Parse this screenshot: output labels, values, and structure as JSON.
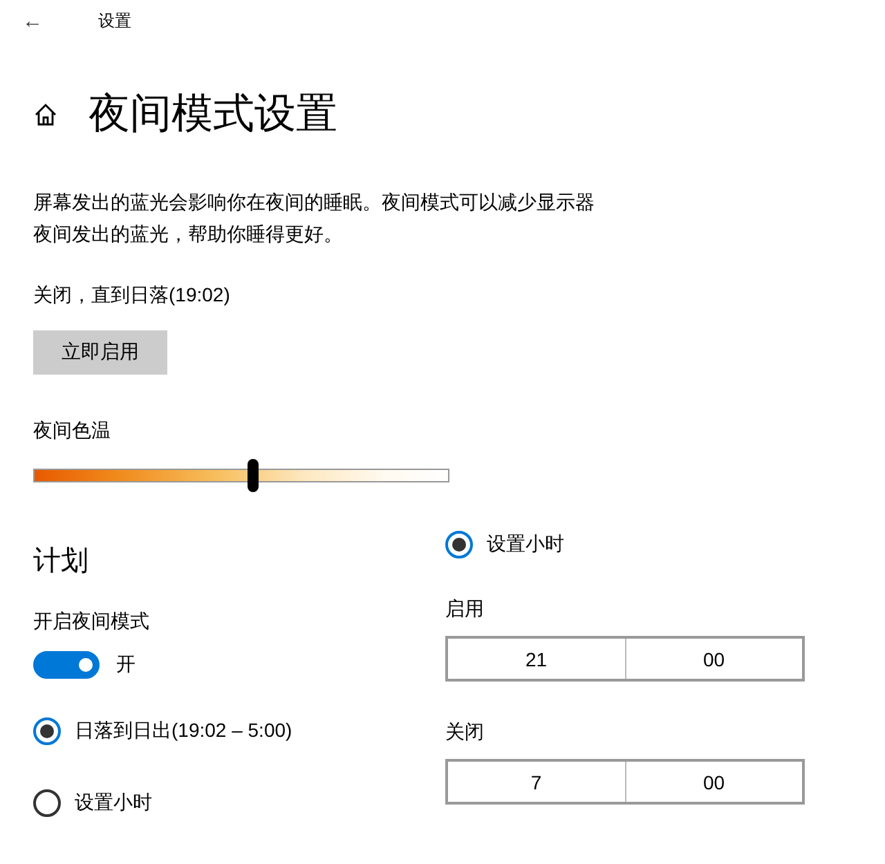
{
  "header": {
    "back": "←",
    "title": "设置"
  },
  "page_title": "夜间模式设置",
  "description": [
    "屏幕发出的蓝光会影响你在夜间的睡眠。夜间模式可以减少显示器",
    "夜间发出的蓝光，帮助你睡得更好。"
  ],
  "status": "关闭，直到日落(19:02)",
  "enable_button": "立即启用",
  "color_temperature": {
    "label": "夜间色温",
    "level": 0.53
  },
  "schedule": {
    "title": "计划",
    "toggle_label": "开启夜间模式",
    "toggle_on": true,
    "toggle_text": "开",
    "options": [
      {
        "label": "日落到日出(19:02 – 5:00)",
        "selected": true
      },
      {
        "label": "设置小时",
        "selected": false
      }
    ]
  },
  "hours": {
    "option": {
      "label": "设置小时",
      "selected": true
    },
    "pickers": [
      {
        "label": "启用",
        "hour": "21",
        "minute": "00"
      },
      {
        "label": "关闭",
        "hour": "7",
        "minute": "00"
      }
    ]
  }
}
